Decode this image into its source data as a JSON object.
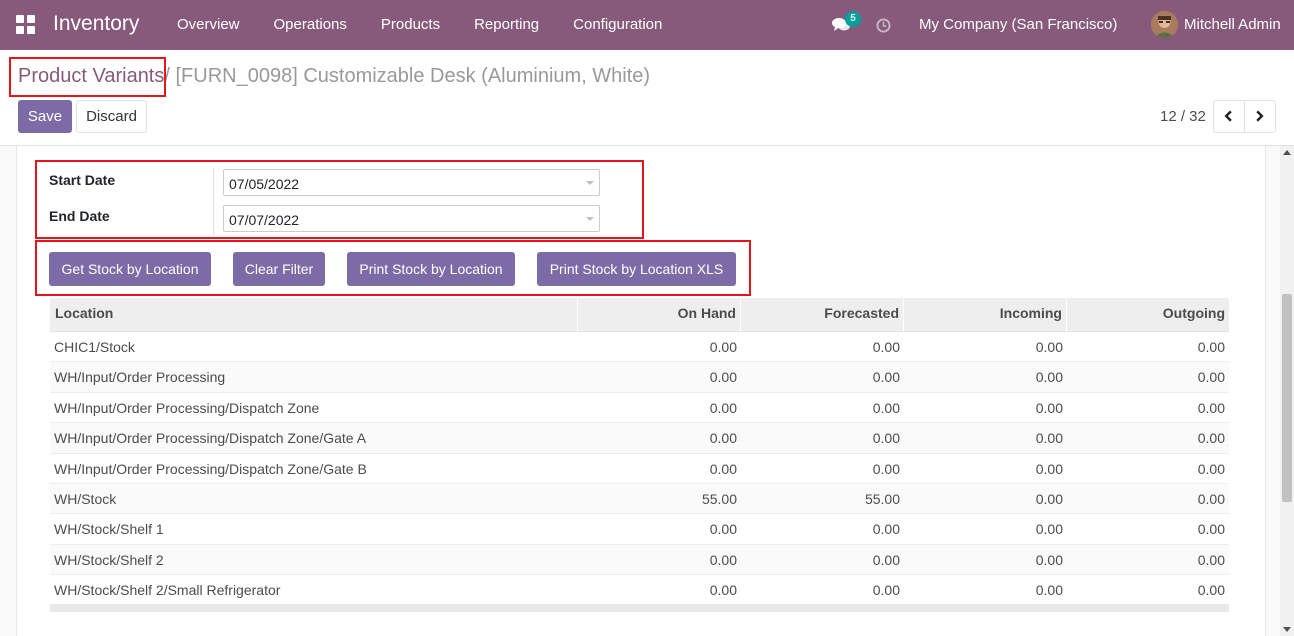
{
  "navbar": {
    "app_name": "Inventory",
    "menu": [
      "Overview",
      "Operations",
      "Products",
      "Reporting",
      "Configuration"
    ],
    "chat_badge": "5",
    "company": "My Company (San Francisco)",
    "user": "Mitchell Admin",
    "icons": [
      "apps-grid-icon",
      "chat-icon",
      "clock-icon",
      "avatar"
    ]
  },
  "breadcrumb": {
    "parent": "Product Variants",
    "separator": "/ ",
    "current": "[FURN_0098] Customizable Desk (Aluminium, White)"
  },
  "toolbar": {
    "save_label": "Save",
    "discard_label": "Discard",
    "pager": "12 / 32"
  },
  "filters": {
    "start_label": "Start Date",
    "start_value": "07/05/2022",
    "end_label": "End Date",
    "end_value": "07/07/2022"
  },
  "actions": {
    "get": "Get Stock by Location",
    "clear": "Clear Filter",
    "print": "Print Stock by Location",
    "print_xls": "Print Stock by Location XLS"
  },
  "table": {
    "headers": [
      "Location",
      "On Hand",
      "Forecasted",
      "Incoming",
      "Outgoing"
    ],
    "rows": [
      [
        "CHIC1/Stock",
        "0.00",
        "0.00",
        "0.00",
        "0.00"
      ],
      [
        "WH/Input/Order Processing",
        "0.00",
        "0.00",
        "0.00",
        "0.00"
      ],
      [
        "WH/Input/Order Processing/Dispatch Zone",
        "0.00",
        "0.00",
        "0.00",
        "0.00"
      ],
      [
        "WH/Input/Order Processing/Dispatch Zone/Gate A",
        "0.00",
        "0.00",
        "0.00",
        "0.00"
      ],
      [
        "WH/Input/Order Processing/Dispatch Zone/Gate B",
        "0.00",
        "0.00",
        "0.00",
        "0.00"
      ],
      [
        "WH/Stock",
        "55.00",
        "55.00",
        "0.00",
        "0.00"
      ],
      [
        "WH/Stock/Shelf 1",
        "0.00",
        "0.00",
        "0.00",
        "0.00"
      ],
      [
        "WH/Stock/Shelf 2",
        "0.00",
        "0.00",
        "0.00",
        "0.00"
      ],
      [
        "WH/Stock/Shelf 2/Small Refrigerator",
        "0.00",
        "0.00",
        "0.00",
        "0.00"
      ]
    ]
  },
  "colors": {
    "navbar": "#875a7b",
    "primary_button": "#7c6ba6",
    "highlight": "#e3161b"
  }
}
